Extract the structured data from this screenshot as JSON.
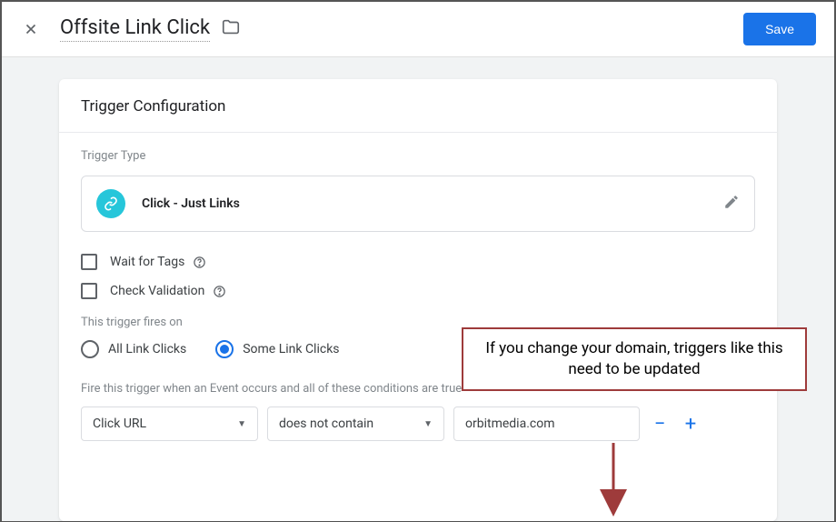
{
  "header": {
    "title": "Offsite Link Click",
    "save_label": "Save"
  },
  "card": {
    "title": "Trigger Configuration",
    "type_label": "Trigger Type",
    "type_value": "Click - Just Links",
    "wait_label": "Wait for Tags",
    "check_label": "Check Validation",
    "fires_label": "This trigger fires on",
    "radio_all": "All Link Clicks",
    "radio_some": "Some Link Clicks",
    "cond_label": "Fire this trigger when an Event occurs and all of these conditions are true",
    "cond_var": "Click URL",
    "cond_op": "does not contain",
    "cond_val": "orbitmedia.com"
  },
  "annotation": {
    "text": "If you change your domain, triggers like this need to be updated"
  }
}
